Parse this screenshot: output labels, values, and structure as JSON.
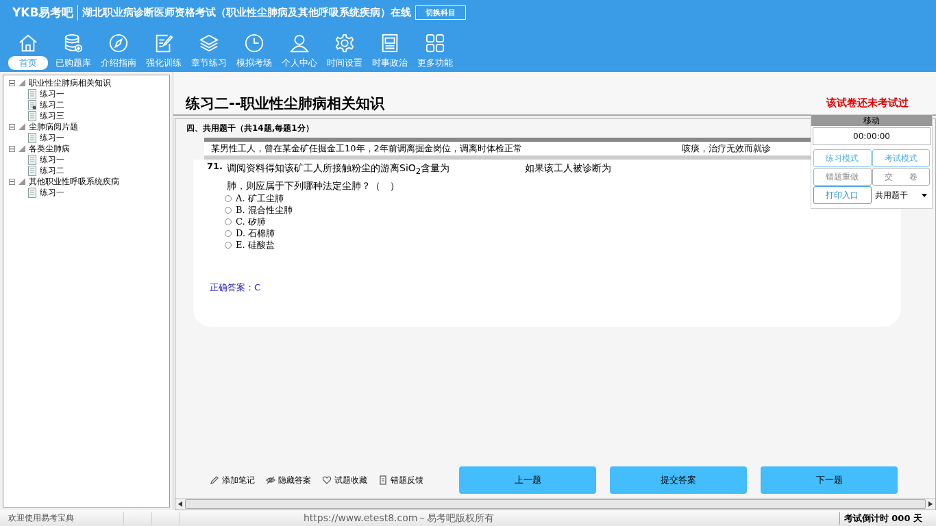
{
  "header": {
    "logo": "YKB易考吧",
    "title": "湖北职业病诊断医师资格考试（职业性尘肺病及其他呼吸系统疾病）在线",
    "switch_button": "切换科目"
  },
  "nav": [
    {
      "label": "首页",
      "selected": true
    },
    {
      "label": "已购题库",
      "selected": false
    },
    {
      "label": "介绍指南",
      "selected": false
    },
    {
      "label": "强化训练",
      "selected": false
    },
    {
      "label": "章节练习",
      "selected": false
    },
    {
      "label": "模拟考场",
      "selected": false
    },
    {
      "label": "个人中心",
      "selected": false
    },
    {
      "label": "时间设置",
      "selected": false
    },
    {
      "label": "时事政治",
      "selected": false
    },
    {
      "label": "更多功能",
      "selected": false
    }
  ],
  "tree": [
    {
      "label": "职业性尘肺病相关知识",
      "expanded": true,
      "children": [
        {
          "label": "练习一",
          "current": false
        },
        {
          "label": "练习二",
          "current": true
        },
        {
          "label": "练习三",
          "current": false
        }
      ]
    },
    {
      "label": "尘肺病阅片题",
      "expanded": true,
      "children": [
        {
          "label": "练习一",
          "current": false
        }
      ]
    },
    {
      "label": "各类尘肺病",
      "expanded": true,
      "children": [
        {
          "label": "练习一",
          "current": false
        },
        {
          "label": "练习二",
          "current": false
        }
      ]
    },
    {
      "label": "其他职业性呼吸系统疾病",
      "expanded": true,
      "children": [
        {
          "label": "练习一",
          "current": false
        }
      ]
    }
  ],
  "exam": {
    "title": "练习二--职业性尘肺病相关知识",
    "status": "该试卷还未考试过",
    "section": "四、共用题干（共14题,每题1分）",
    "stem_parts": [
      "某男性工人，曾在某金矿任掘金工10年，2年前调离掘金岗位，调离时体检正常",
      "咳痰，治疗无效而就诊"
    ],
    "question": {
      "number": "71.",
      "lines": [
        "调阅资料得知该矿工人所接触粉尘的游离SiO$_{2}$含量为",
        "如果该工人被诊断为",
        "肺，则应属于下列哪种法定尘肺？（　）"
      ],
      "options": [
        {
          "label": "A. 矿工尘肺",
          "checked": false
        },
        {
          "label": "B. 混合性尘肺",
          "checked": false
        },
        {
          "label": "C. 矽肺",
          "checked": false
        },
        {
          "label": "D. 石棉肺",
          "checked": false
        },
        {
          "label": "E. 硅酸盐",
          "checked": false
        }
      ],
      "answer": "正确答案：C"
    },
    "tools": [
      "添加笔记",
      "隐藏答案",
      "试题收藏",
      "错题反馈"
    ],
    "buttons": [
      "上一题",
      "提交答案",
      "下一题"
    ]
  },
  "panel": {
    "title": "移动",
    "timer": "00:00:00",
    "buttons": [
      {
        "label": "练习模式",
        "kind": "mode"
      },
      {
        "label": "考试模式",
        "kind": "mode"
      },
      {
        "label": "错题重做",
        "kind": "plain"
      },
      {
        "label": "交　　卷",
        "kind": "plain"
      },
      {
        "label": "打印入口",
        "kind": "print"
      }
    ],
    "select": "共用题干"
  },
  "status_bar": {
    "welcome": "欢迎使用易考宝典",
    "copyright": "https://www.etest8.com－易考吧版权所有",
    "countdown": "考试倒计时 000 天"
  }
}
